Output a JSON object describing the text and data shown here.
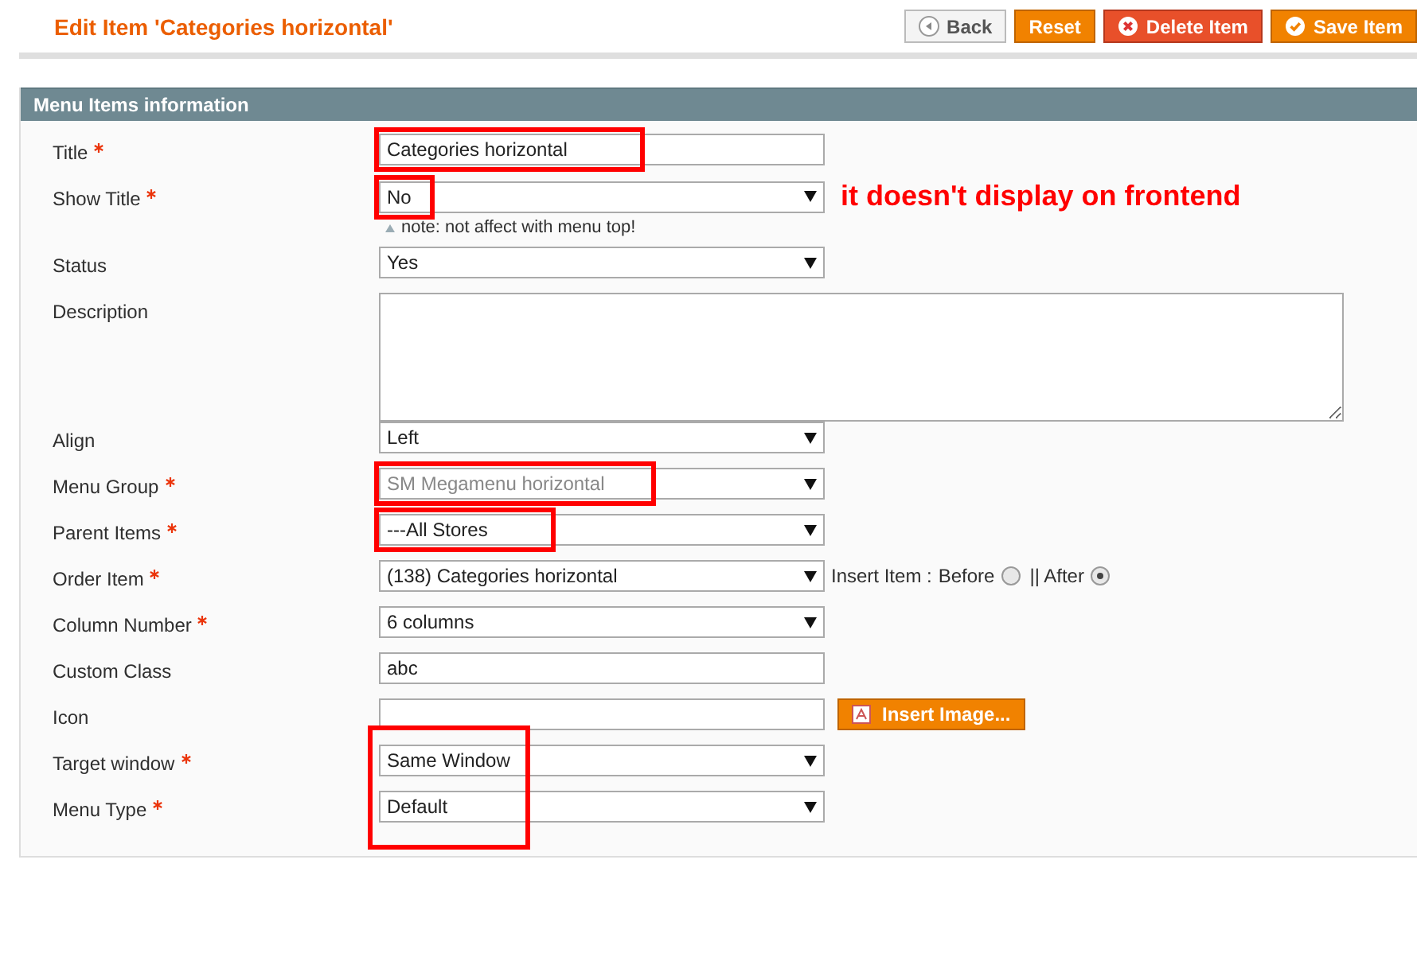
{
  "page_title": "Edit Item 'Categories horizontal'",
  "actions": [
    {
      "label": "Back",
      "kind": "back"
    },
    {
      "label": "Reset",
      "kind": "plain"
    },
    {
      "label": "Delete Item",
      "kind": "delete"
    },
    {
      "label": "Save Item",
      "kind": "save"
    }
  ],
  "section": {
    "title": "Menu Items information"
  },
  "fields": [
    {
      "label": "Title",
      "required": true,
      "kind": "text",
      "value": "Categories horizontal",
      "boxed": true
    },
    {
      "label": "Show Title",
      "required": true,
      "kind": "select",
      "value": "No",
      "boxed": true,
      "note": "note: not affect with menu top!",
      "annotation": "it doesn't display on frontend"
    },
    {
      "label": "Status",
      "required": false,
      "kind": "select",
      "value": "Yes"
    },
    {
      "label": "Description",
      "required": false,
      "kind": "textarea"
    },
    {
      "label": "Align",
      "required": false,
      "kind": "select",
      "value": "Left"
    },
    {
      "label": "Menu Group",
      "required": true,
      "kind": "select",
      "value": "SM Megamenu horizontal",
      "disabled": true,
      "boxed": true
    },
    {
      "label": "Parent Items",
      "required": true,
      "kind": "select",
      "value": "---All Stores",
      "boxed": true
    },
    {
      "label": "Order Item",
      "required": true,
      "kind": "select",
      "value": "(138) Categories horizontal",
      "insert": {
        "label": "Insert Item :",
        "options": [
          {
            "label": "Before",
            "selected": false
          },
          {
            "label": "|| After",
            "selected": true
          }
        ]
      }
    },
    {
      "label": "Column Number",
      "required": true,
      "kind": "select",
      "value": "6 columns"
    },
    {
      "label": "Custom Class",
      "required": false,
      "kind": "text",
      "value": "abc"
    },
    {
      "label": "Icon",
      "required": false,
      "kind": "text",
      "button": "Insert Image..."
    },
    {
      "label": "Target window",
      "required": true,
      "kind": "select",
      "value": "Same Window",
      "column_marked": true
    },
    {
      "label": "Menu Type",
      "required": true,
      "kind": "select",
      "value": "Default",
      "column_marked": true
    }
  ]
}
